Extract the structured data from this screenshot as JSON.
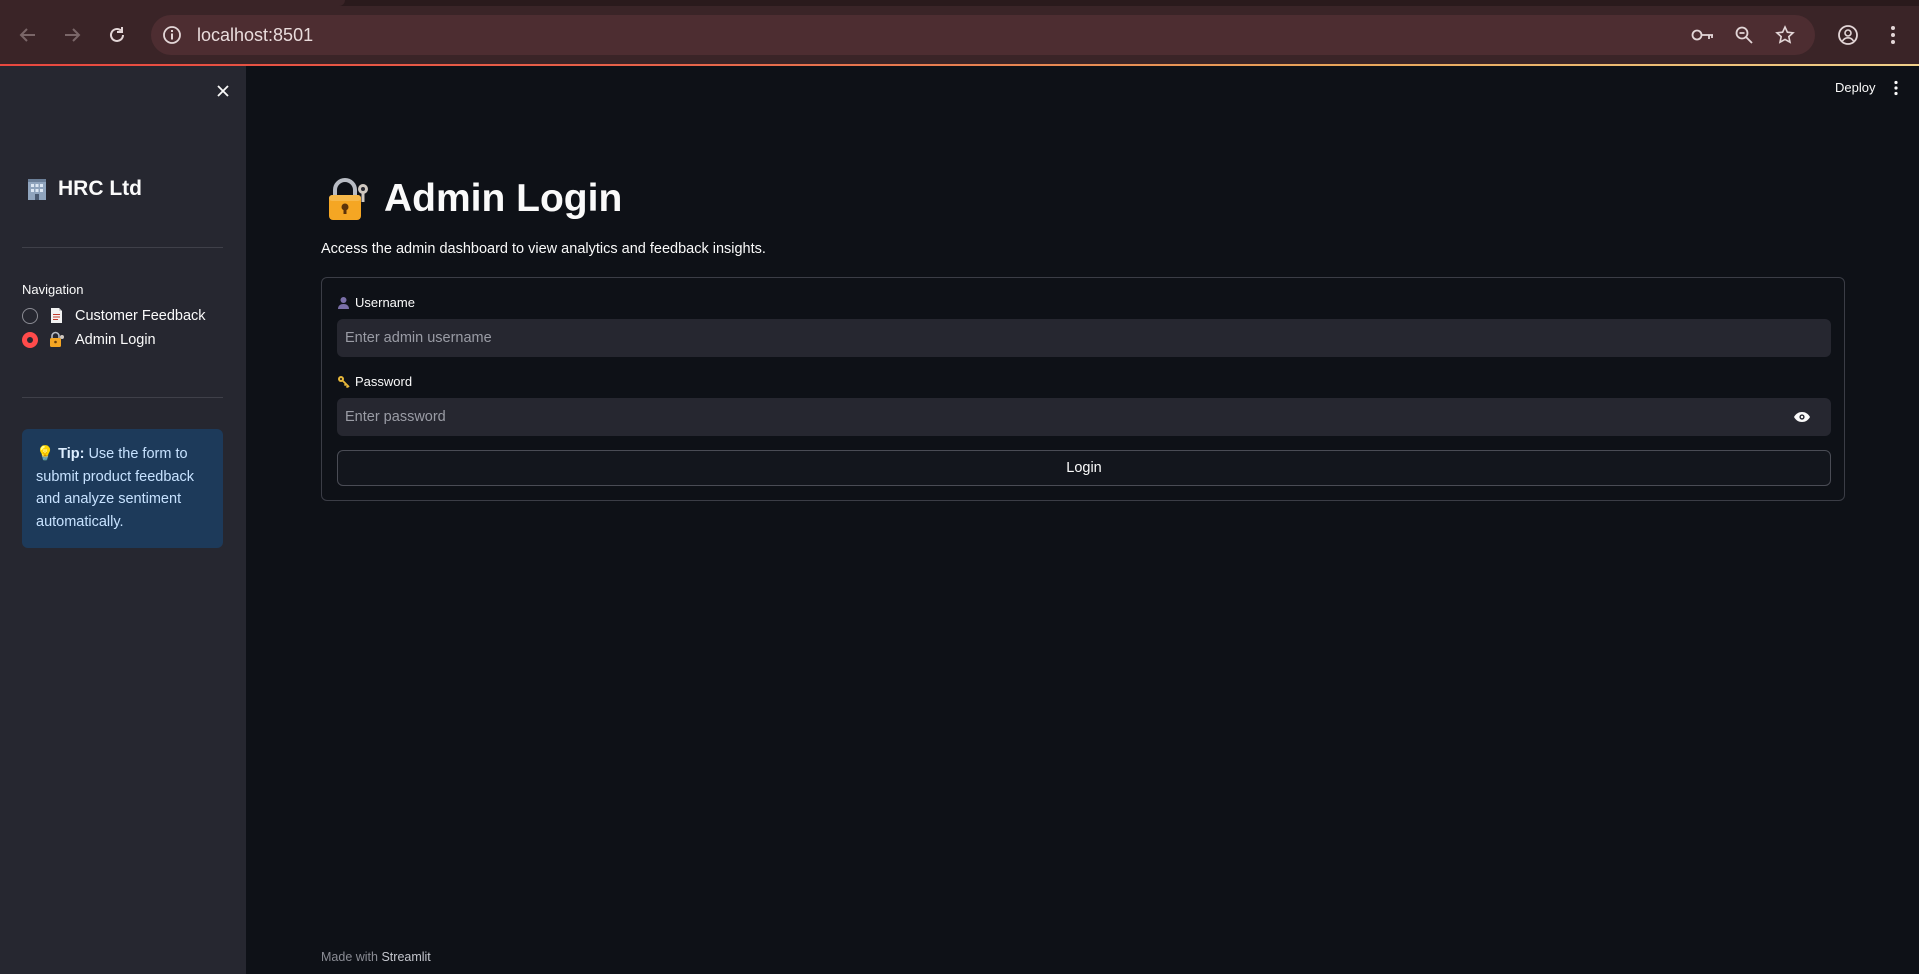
{
  "browser": {
    "url": "localhost:8501"
  },
  "sidebar": {
    "brand": "HRC Ltd",
    "brand_icon": "office-building-emoji",
    "nav_heading": "Navigation",
    "items": [
      {
        "label": "Customer Feedback",
        "icon": "page-facing-up-emoji",
        "selected": false
      },
      {
        "label": "Admin Login",
        "icon": "locked-with-key-emoji",
        "selected": true
      }
    ],
    "tip": {
      "bold": "Tip:",
      "text": "Use the form to submit product feedback and analyze sentiment automatically."
    }
  },
  "toolbar": {
    "deploy_label": "Deploy"
  },
  "main": {
    "title": "Admin Login",
    "subtitle": "Access the admin dashboard to view analytics and feedback insights.",
    "username_label": "Username",
    "username_placeholder": "Enter admin username",
    "password_label": "Password",
    "password_placeholder": "Enter password",
    "login_label": "Login"
  },
  "footer": {
    "prefix": "Made with",
    "brand": "Streamlit"
  },
  "colors": {
    "accent": "#ff4b4b",
    "background": "#0e1117",
    "sidebar": "#262730",
    "tip_bg": "#1d3a5a"
  }
}
